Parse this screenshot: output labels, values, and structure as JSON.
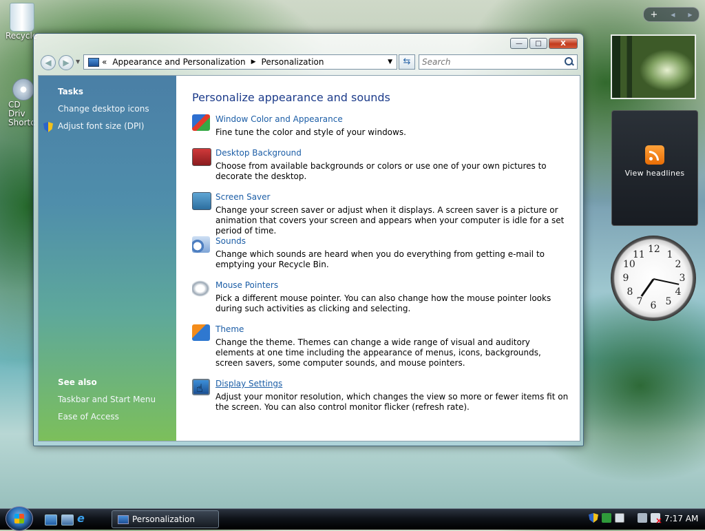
{
  "desktop": {
    "icons": [
      {
        "label": "Recycle"
      },
      {
        "label": "CD Driv",
        "label2": "Shortc"
      }
    ]
  },
  "gadgets": {
    "sidebar_controls": {
      "add": "+",
      "prev": "◀",
      "next": "▶"
    },
    "feed": {
      "label": "View headlines"
    },
    "clock": {
      "numbers": [
        "12",
        "1",
        "2",
        "3",
        "4",
        "5",
        "6",
        "7",
        "8",
        "9",
        "10",
        "11"
      ]
    }
  },
  "window": {
    "title": "Personalization",
    "controls": {
      "minimize": "—",
      "maximize": "□",
      "close": "X"
    },
    "address": {
      "prefix": "«",
      "crumbs": [
        "Appearance and Personalization",
        "Personalization"
      ],
      "separator": "▶",
      "dropdown": "▼"
    },
    "refresh": "⇆",
    "search": {
      "placeholder": "Search"
    },
    "left_pane": {
      "tasks_heading": "Tasks",
      "tasks": [
        "Change desktop icons",
        "Adjust font size (DPI)"
      ],
      "see_also_heading": "See also",
      "see_also": [
        "Taskbar and Start Menu",
        "Ease of Access"
      ]
    },
    "main": {
      "title": "Personalize appearance and sounds",
      "items": [
        {
          "link": "Window Color and Appearance",
          "desc": "Fine tune the color and style of your windows."
        },
        {
          "link": "Desktop Background",
          "desc": "Choose from available backgrounds or colors or use one of your own pictures to decorate the desktop."
        },
        {
          "link": "Screen Saver",
          "desc": "Change your screen saver or adjust when it displays. A screen saver is a picture or animation that covers your screen and appears when your computer is idle for a set period of time."
        },
        {
          "link": "Sounds",
          "desc": "Change which sounds are heard when you do everything from getting e-mail to emptying your Recycle Bin."
        },
        {
          "link": "Mouse Pointers",
          "desc": "Pick a different mouse pointer. You can also change how the mouse pointer looks during such activities as clicking and selecting."
        },
        {
          "link": "Theme",
          "desc": "Change the theme. Themes can change a wide range of visual and auditory elements at one time including the appearance of menus, icons, backgrounds, screen savers, some computer sounds, and mouse pointers."
        },
        {
          "link": "Display Settings",
          "desc": "Adjust your monitor resolution, which changes the view so more or fewer items fit on the screen. You can also control monitor flicker (refresh rate)."
        }
      ]
    }
  },
  "taskbar": {
    "task_button": "Personalization",
    "clock": "7:17 AM"
  }
}
